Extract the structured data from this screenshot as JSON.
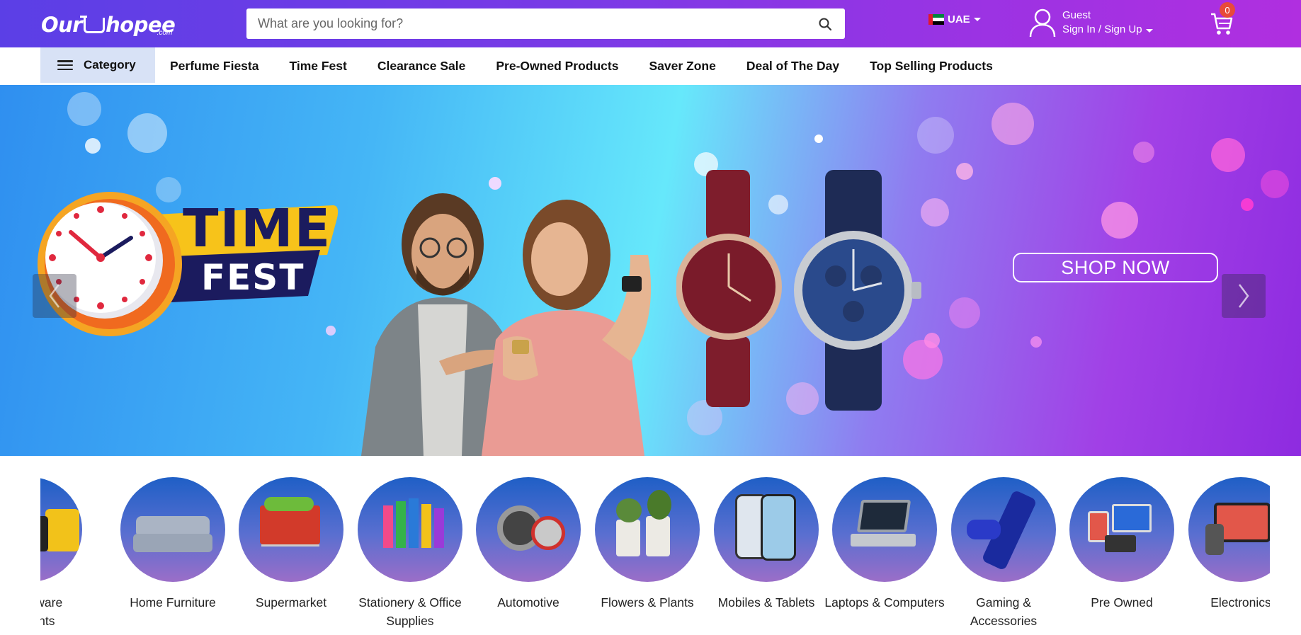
{
  "header": {
    "logo_text_a": "Our",
    "logo_text_b": "hopee",
    "logo_sub": ".com",
    "search_placeholder": "What are you looking for?",
    "country": "UAE",
    "account_line1": "Guest",
    "account_line2": "Sign In / Sign Up",
    "cart_count": "0",
    "colors": {
      "header_start": "#5b3fe6",
      "header_end": "#b02fe0",
      "badge": "#e84a3a"
    }
  },
  "nav": {
    "category_label": "Category",
    "links": [
      "Perfume Fiesta",
      "Time Fest",
      "Clearance Sale",
      "Pre-Owned Products",
      "Saver Zone",
      "Deal of The Day",
      "Top Selling Products"
    ]
  },
  "hero": {
    "badge_line1": "TIME",
    "badge_line2": "FEST",
    "cta": "SHOP NOW",
    "icons": [
      "prev-arrow-icon",
      "next-arrow-icon"
    ]
  },
  "categories": [
    {
      "label": "& Hardware\nuipments",
      "icon": "power-tools"
    },
    {
      "label": "Home Furniture",
      "icon": "sofa"
    },
    {
      "label": "Supermarket",
      "icon": "shopping-cart"
    },
    {
      "label": "Stationery & Office Supplies",
      "icon": "stationery"
    },
    {
      "label": "Automotive",
      "icon": "car-parts"
    },
    {
      "label": "Flowers & Plants",
      "icon": "plants"
    },
    {
      "label": "Mobiles & Tablets",
      "icon": "smartphone"
    },
    {
      "label": "Laptops & Computers",
      "icon": "laptop"
    },
    {
      "label": "Gaming & Accessories",
      "icon": "game-console"
    },
    {
      "label": "Pre Owned",
      "icon": "devices"
    },
    {
      "label": "Electronics",
      "icon": "electronics"
    }
  ]
}
